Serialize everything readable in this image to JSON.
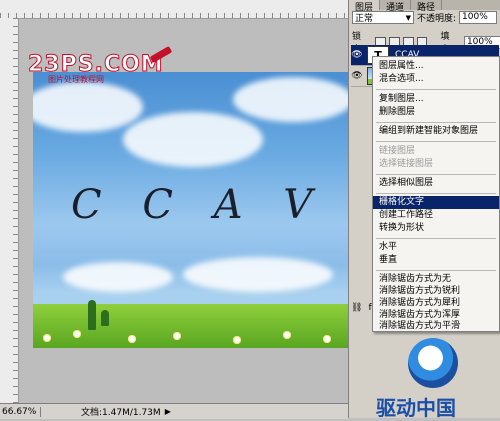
{
  "status_bar": {
    "zoom": "66.67%",
    "doc_info": "文档:1.47M/1.73M",
    "arrow": "▶"
  },
  "logo": {
    "main": "23PS.COM",
    "sub": "图片处理教程网"
  },
  "canvas": {
    "text_layer_content": "C C A V"
  },
  "layers_panel": {
    "tabs": [
      "图层",
      "通道",
      "路径"
    ],
    "blend_mode": "正常",
    "opacity_label": "不透明度:",
    "opacity_value": "100%",
    "lock_label": "锁定:",
    "fill_label": "填充:",
    "fill_value": "100%",
    "layers": [
      {
        "thumb": "T",
        "name": "CCAV",
        "type": "text"
      },
      {
        "thumb": "",
        "name": "",
        "type": "image"
      }
    ],
    "bottom_icons": [
      "⛓",
      "fx",
      "◐",
      "▢",
      "▭",
      "🗑"
    ]
  },
  "context_menu": {
    "items": [
      {
        "label": "图层属性...",
        "state": "enabled"
      },
      {
        "label": "混合选项...",
        "state": "enabled"
      },
      {
        "label": "复制图层...",
        "state": "enabled"
      },
      {
        "label": "删除图层",
        "state": "enabled"
      },
      {
        "label": "编组到新建智能对象图层",
        "state": "enabled"
      },
      {
        "label": "链接图层",
        "state": "disabled"
      },
      {
        "label": "选择链接图层",
        "state": "disabled"
      },
      {
        "label": "选择相似图层",
        "state": "enabled"
      },
      {
        "label": "栅格化文字",
        "state": "highlighted"
      },
      {
        "label": "创建工作路径",
        "state": "enabled"
      },
      {
        "label": "转换为形状",
        "state": "enabled"
      },
      {
        "label": "水平",
        "state": "enabled"
      },
      {
        "label": "垂直",
        "state": "enabled"
      },
      {
        "label": "消除锯齿方式为无",
        "state": "enabled"
      },
      {
        "label": "消除锯齿方式为锐利",
        "state": "enabled"
      },
      {
        "label": "消除锯齿方式为犀利",
        "state": "enabled"
      },
      {
        "label": "消除锯齿方式为浑厚",
        "state": "enabled"
      },
      {
        "label": "消除锯齿方式为平滑",
        "state": "enabled"
      }
    ]
  },
  "watermark": {
    "text": "驱动中国"
  },
  "colors": {
    "accent": "#0a246a",
    "logo_red": "#c4102a",
    "menu_bg": "#f5f4f0"
  }
}
